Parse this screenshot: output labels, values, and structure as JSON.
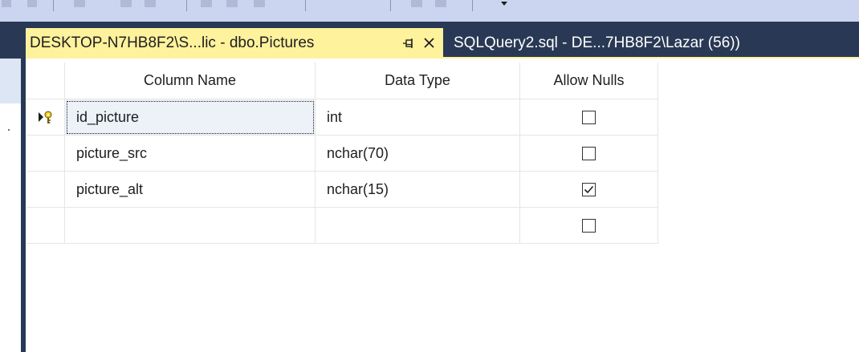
{
  "tabs": [
    {
      "label": "DESKTOP-N7HB8F2\\S...lic - dbo.Pictures",
      "active": true
    },
    {
      "label": "SQLQuery2.sql - DE...7HB8F2\\Lazar (56))",
      "active": false
    }
  ],
  "icons": {
    "pin": "pin-icon",
    "close": "close-icon",
    "primary_key": "primary-key-icon",
    "current_row": "current-row-arrow-icon"
  },
  "colors": {
    "active_tab": "#fff29d",
    "tab_strip": "#293955",
    "toolbar": "#ccd5f0",
    "grid_line": "#e5e5e5"
  },
  "grid": {
    "headers": {
      "column_name": "Column Name",
      "data_type": "Data Type",
      "allow_nulls": "Allow Nulls"
    },
    "rows": [
      {
        "column_name": "id_picture",
        "data_type": "int",
        "allow_nulls": false,
        "primary_key": true,
        "current": true
      },
      {
        "column_name": "picture_src",
        "data_type": "nchar(70)",
        "allow_nulls": false,
        "primary_key": false,
        "current": false
      },
      {
        "column_name": "picture_alt",
        "data_type": "nchar(15)",
        "allow_nulls": true,
        "primary_key": false,
        "current": false
      },
      {
        "column_name": "",
        "data_type": "",
        "allow_nulls": false,
        "primary_key": false,
        "current": false
      }
    ]
  }
}
